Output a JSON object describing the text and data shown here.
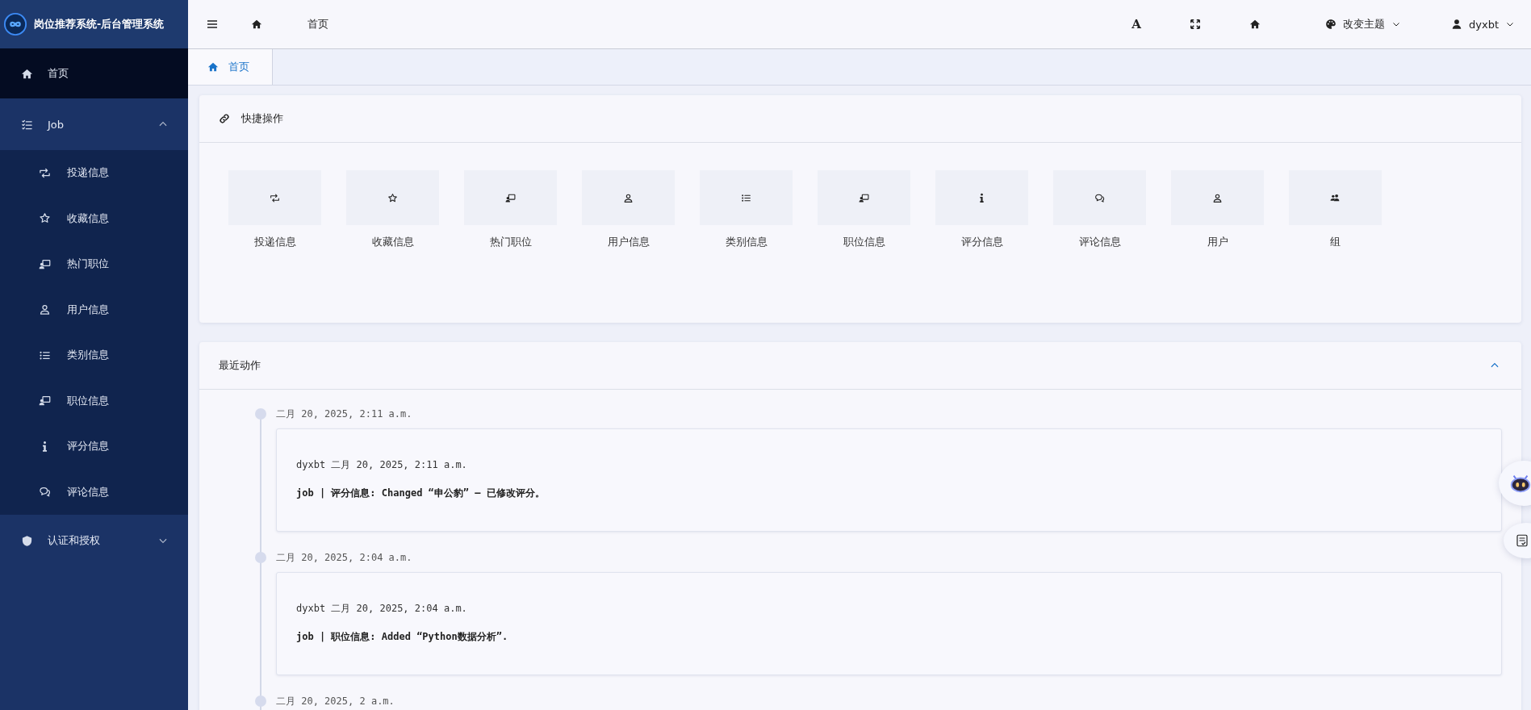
{
  "sidebar": {
    "title": "岗位推荐系统-后台管理系统",
    "items": [
      {
        "label": "首页",
        "kind": "home",
        "selected": true
      },
      {
        "label": "Job",
        "kind": "list-check",
        "selected": false,
        "expanded": true,
        "children": [
          {
            "label": "投递信息",
            "kind": "retweet",
            "selected": false
          },
          {
            "label": "收藏信息",
            "kind": "star",
            "selected": false
          },
          {
            "label": "热门职位",
            "kind": "presenter",
            "selected": false
          },
          {
            "label": "用户信息",
            "kind": "user",
            "selected": false
          },
          {
            "label": "类别信息",
            "kind": "list",
            "selected": false
          },
          {
            "label": "职位信息",
            "kind": "presenter",
            "selected": false
          },
          {
            "label": "评分信息",
            "kind": "info",
            "selected": false
          },
          {
            "label": "评论信息",
            "kind": "comments",
            "selected": false
          }
        ]
      },
      {
        "label": "认证和授权",
        "kind": "shield",
        "selected": false,
        "expanded": false
      }
    ]
  },
  "header": {
    "breadcrumb": "首页",
    "font_button": "A",
    "theme": "改变主题",
    "user": "dyxbt"
  },
  "tabs": [
    {
      "label": "首页",
      "selected": true
    }
  ],
  "quick_actions": {
    "title": "快捷操作",
    "items": [
      {
        "label": "投递信息",
        "kind": "retweet"
      },
      {
        "label": "收藏信息",
        "kind": "star"
      },
      {
        "label": "热门职位",
        "kind": "presenter"
      },
      {
        "label": "用户信息",
        "kind": "user"
      },
      {
        "label": "类别信息",
        "kind": "list"
      },
      {
        "label": "职位信息",
        "kind": "presenter"
      },
      {
        "label": "评分信息",
        "kind": "info"
      },
      {
        "label": "评论信息",
        "kind": "comments"
      },
      {
        "label": "用户",
        "kind": "user"
      },
      {
        "label": "组",
        "kind": "users"
      }
    ]
  },
  "recent_actions": {
    "title": "最近动作",
    "expanded": true,
    "entries": [
      {
        "time": "二月 20, 2025, 2:11 a.m.",
        "meta": "dyxbt 二月 20, 2025, 2:11 a.m.",
        "action": "job | 评分信息: Changed “申公豹” — 已修改评分。"
      },
      {
        "time": "二月 20, 2025, 2:04 a.m.",
        "meta": "dyxbt 二月 20, 2025, 2:04 a.m.",
        "action": "job | 职位信息: Added “Python数据分析”."
      },
      {
        "time": "二月 20, 2025, 2 a.m."
      }
    ]
  }
}
